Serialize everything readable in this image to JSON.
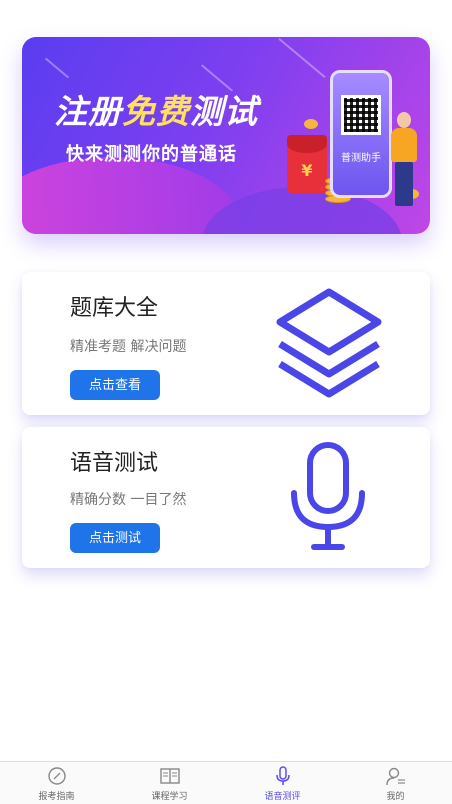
{
  "banner": {
    "title_part1": "注册",
    "title_highlight": "免费",
    "title_part2": "测试",
    "subtitle": "快来测测你的普通话",
    "phone_caption": "普测助手",
    "yen_symbol": "¥"
  },
  "cards": [
    {
      "title": "题库大全",
      "description": "精准考题 解决问题",
      "button_label": "点击查看",
      "icon": "layers-icon"
    },
    {
      "title": "语音测试",
      "description": "精确分数 一目了然",
      "button_label": "点击测试",
      "icon": "microphone-icon"
    }
  ],
  "tabbar": {
    "items": [
      {
        "label": "报考指南",
        "icon": "compass-icon",
        "active": false
      },
      {
        "label": "课程学习",
        "icon": "book-icon",
        "active": false
      },
      {
        "label": "语音测评",
        "icon": "microphone-icon",
        "active": true
      },
      {
        "label": "我的",
        "icon": "user-icon",
        "active": false
      }
    ]
  },
  "colors": {
    "accent": "#5a4cf0",
    "button": "#1e74e8",
    "banner_start": "#5a3df0",
    "banner_end": "#c046e6",
    "highlight": "#ffe15a"
  }
}
